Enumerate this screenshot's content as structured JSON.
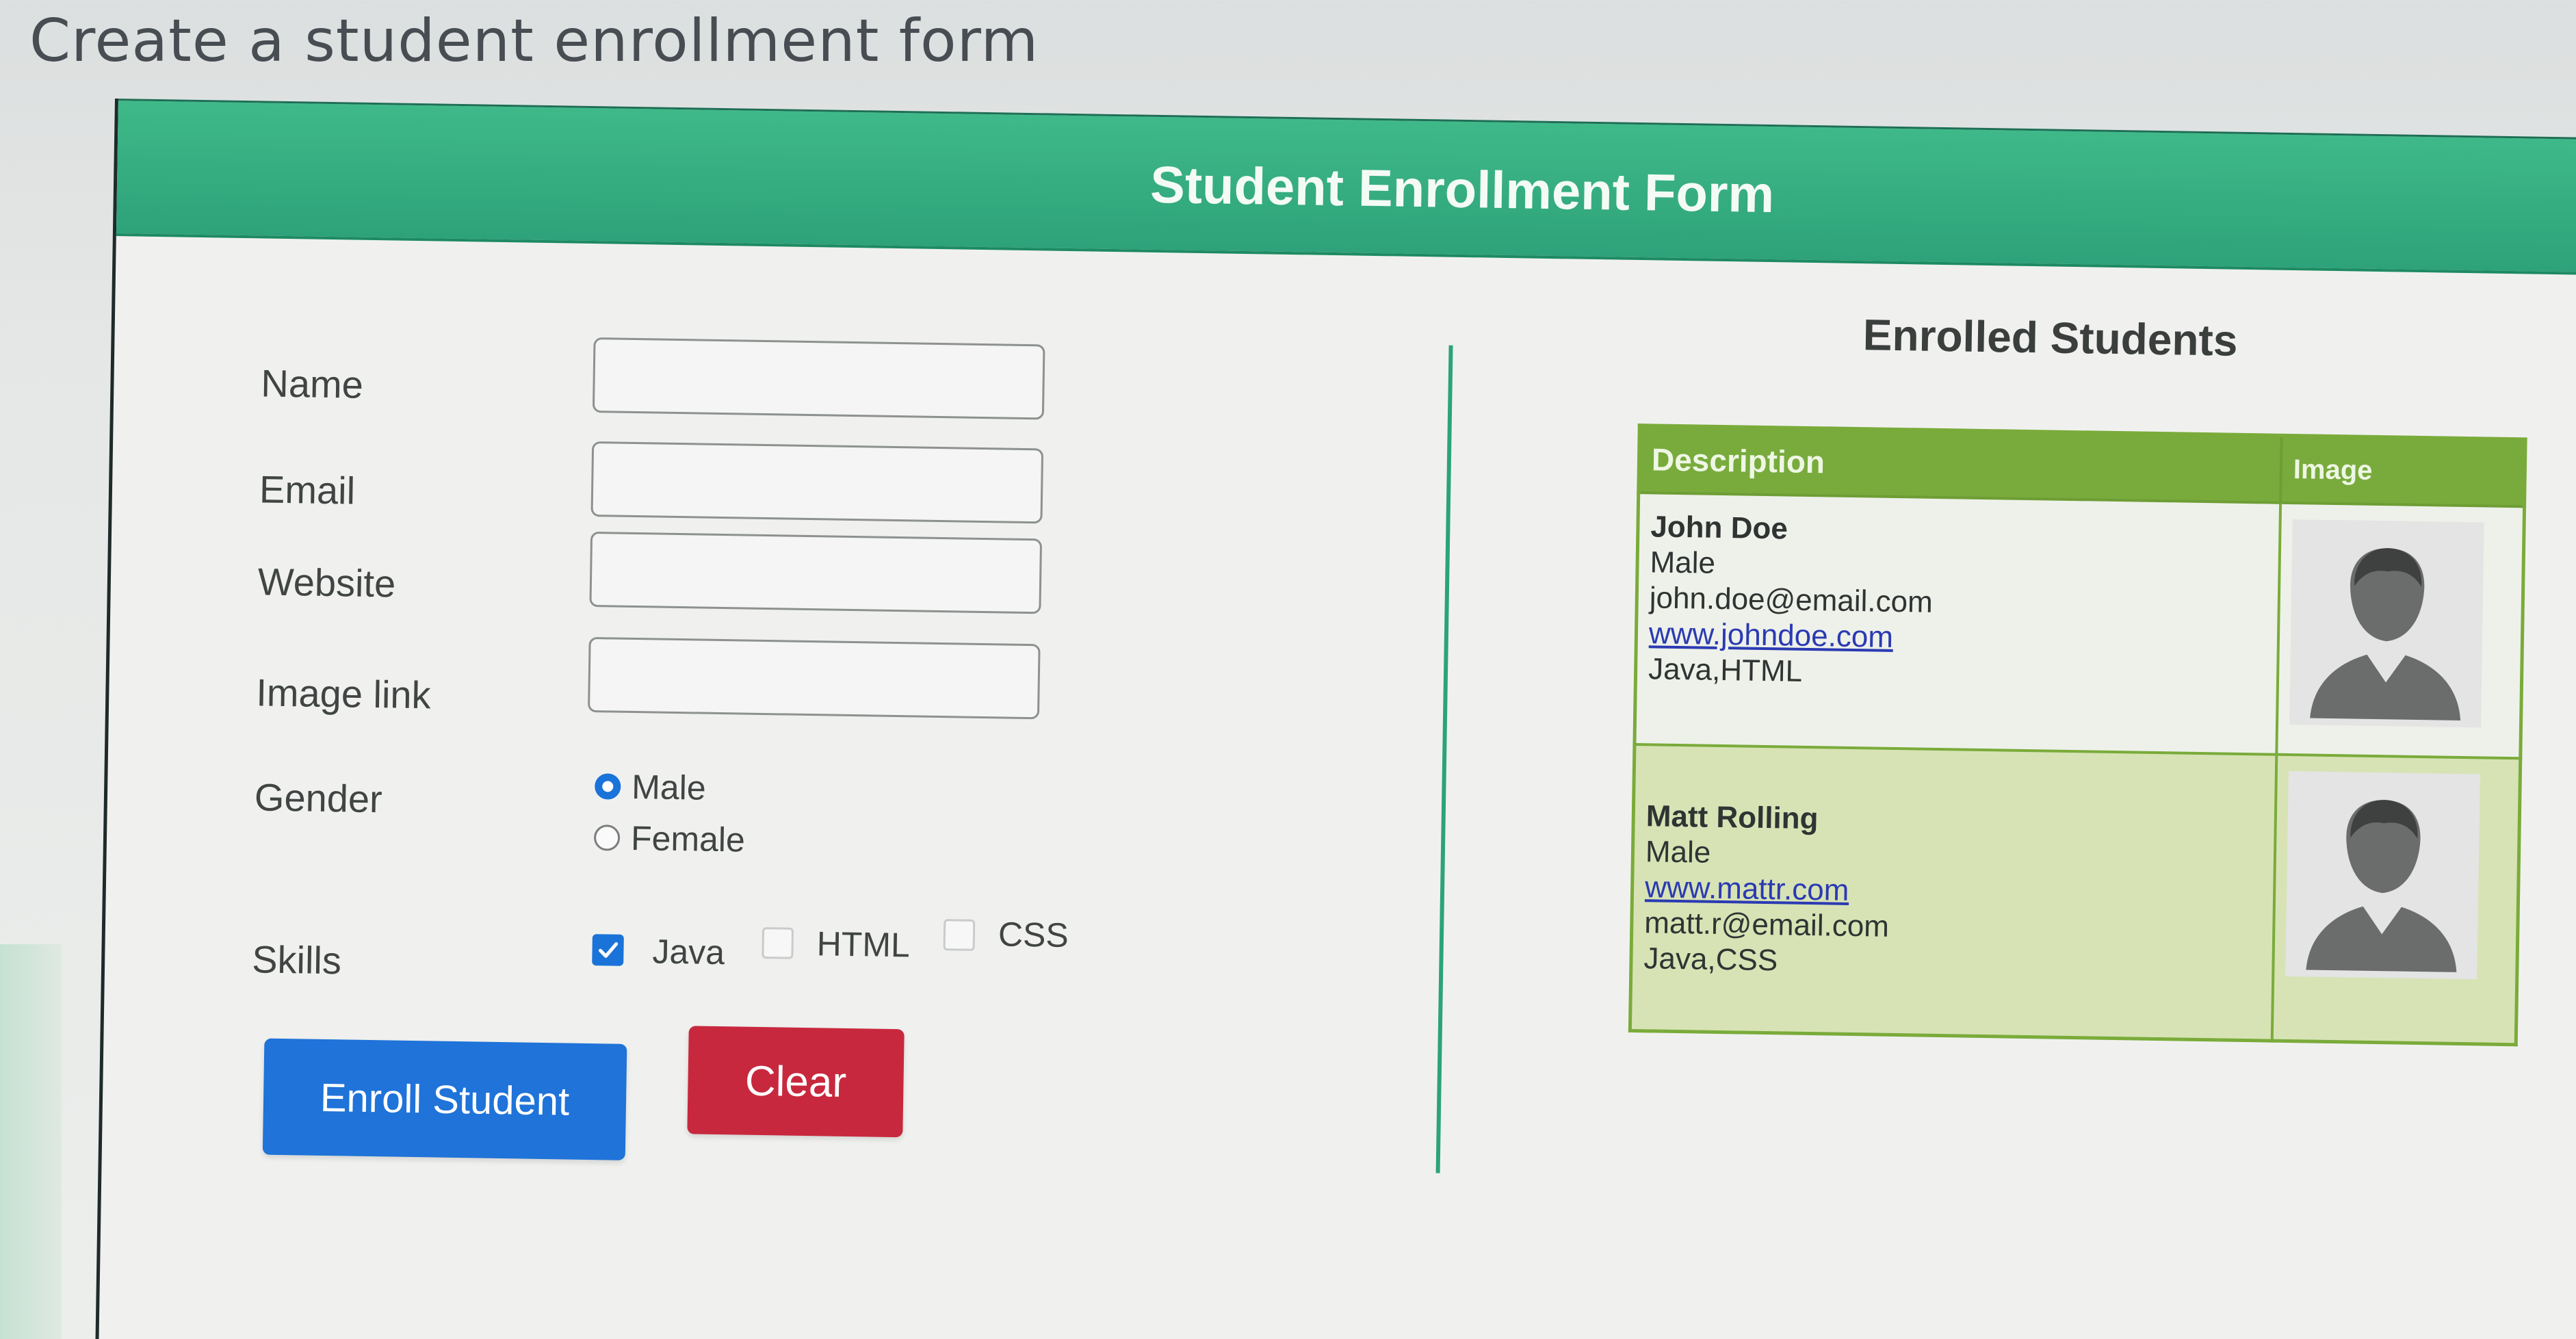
{
  "page": {
    "heading": "Create a student enrollment form"
  },
  "form": {
    "title": "Student Enrollment Form",
    "fields": {
      "name": {
        "label": "Name",
        "value": "",
        "placeholder": ""
      },
      "email": {
        "label": "Email",
        "value": "",
        "placeholder": ""
      },
      "website": {
        "label": "Website",
        "value": "",
        "placeholder": ""
      },
      "image_link": {
        "label": "Image link",
        "value": "",
        "placeholder": ""
      }
    },
    "gender": {
      "label": "Gender",
      "options": [
        {
          "label": "Male",
          "checked": true
        },
        {
          "label": "Female",
          "checked": false
        }
      ]
    },
    "skills": {
      "label": "Skills",
      "options": [
        {
          "label": "Java",
          "checked": true
        },
        {
          "label": "HTML",
          "checked": false
        },
        {
          "label": "CSS",
          "checked": false
        }
      ]
    },
    "buttons": {
      "enroll": "Enroll Student",
      "clear": "Clear"
    }
  },
  "enrolled": {
    "title": "Enrolled Students",
    "columns": [
      "Description",
      "Image"
    ],
    "students": [
      {
        "name": "John Doe",
        "lines": [
          "Male",
          "john.doe@email.com",
          "www.johndoe.com",
          "Java,HTML"
        ],
        "avatar_icon": "person-silhouette-icon"
      },
      {
        "name": "Matt Rolling",
        "lines": [
          "Male",
          "www.mattr.com",
          "matt.r@email.com",
          "Java,CSS"
        ],
        "avatar_icon": "person-silhouette-icon"
      }
    ]
  },
  "colors": {
    "banner": "#3fb989",
    "divider": "#2ca37a",
    "table_header": "#78ab3c",
    "row_highlight": "#d7e3b5",
    "enroll_button": "#1f73d9",
    "clear_button": "#c8283e",
    "link": "#2b3ab2"
  }
}
